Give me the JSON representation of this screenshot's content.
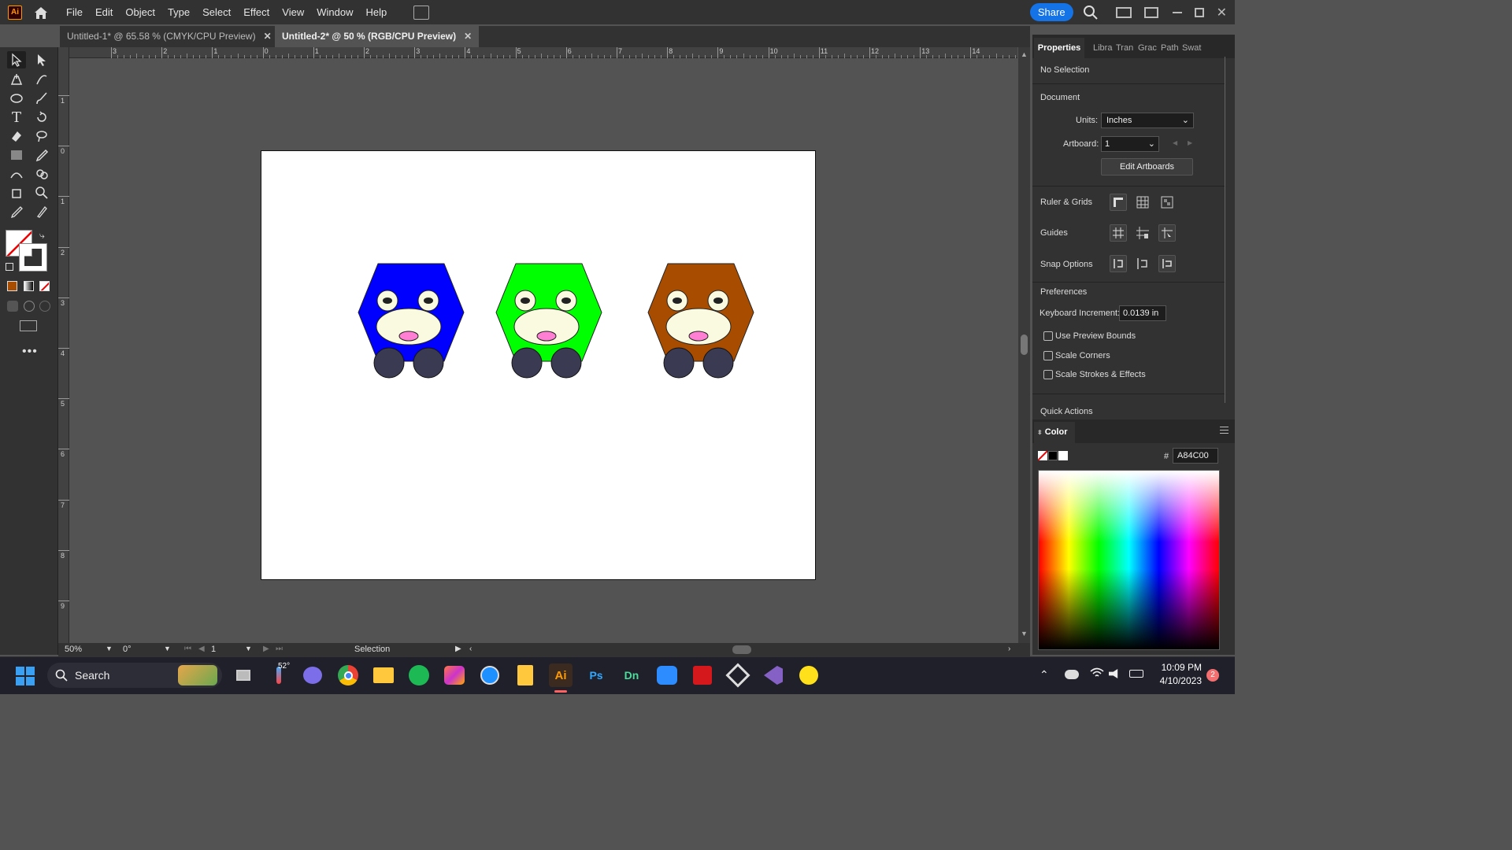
{
  "app": {
    "logo": "Ai"
  },
  "menu": [
    "File",
    "Edit",
    "Object",
    "Type",
    "Select",
    "Effect",
    "View",
    "Window",
    "Help"
  ],
  "titlebar": {
    "share_label": "Share"
  },
  "tabs": [
    {
      "label": "Untitled-1* @ 65.58 % (CMYK/CPU Preview)",
      "close": "✕",
      "active": false
    },
    {
      "label": "Untitled-2* @ 50 % (RGB/CPU Preview)",
      "close": "✕",
      "active": true
    }
  ],
  "ruler_h": [
    "3",
    "2",
    "1",
    "0",
    "1",
    "2",
    "3",
    "4",
    "5",
    "6",
    "7",
    "8",
    "9",
    "10",
    "11",
    "12",
    "13",
    "14"
  ],
  "ruler_v": [
    "1",
    "0",
    "1",
    "2",
    "3",
    "4",
    "5",
    "6",
    "7",
    "8",
    "9"
  ],
  "characters": [
    {
      "name": "blue",
      "body_color": "#0000ff"
    },
    {
      "name": "green",
      "body_color": "#00ff00"
    },
    {
      "name": "brown",
      "body_color": "#a84c00"
    }
  ],
  "character_colors": {
    "belly": "#fafae0",
    "nose": "#ff7fd4",
    "wheel": "#3a3a52",
    "pupil": "#222222"
  },
  "status": {
    "zoom": "50%",
    "rotation": "0°",
    "artboard": "1",
    "tool": "Selection"
  },
  "panel": {
    "tabs": [
      "Properties",
      "Libra",
      "Tran",
      "Grac",
      "Path",
      "Swat"
    ],
    "no_selection": "No Selection",
    "document": "Document",
    "units_label": "Units:",
    "units_value": "Inches",
    "artboard_label": "Artboard:",
    "artboard_value": "1",
    "edit_artboards": "Edit Artboards",
    "ruler_grids": "Ruler & Grids",
    "guides": "Guides",
    "snap_options": "Snap Options",
    "preferences": "Preferences",
    "keyboard_increment_label": "Keyboard Increment:",
    "keyboard_increment_value": "0.0139 in",
    "checkboxes": [
      "Use Preview Bounds",
      "Scale Corners",
      "Scale Strokes & Effects"
    ],
    "quick_actions": "Quick Actions",
    "color_tab": "Color",
    "hex_prefix": "#",
    "hex_value": "A84C00"
  },
  "taskbar": {
    "search": "Search",
    "weather": "52°",
    "time": "10:09 PM",
    "date": "4/10/2023",
    "notifications": "2",
    "apps": [
      "start",
      "search",
      "widgets",
      "task-view",
      "thermo",
      "teams",
      "chrome",
      "explorer",
      "spotify",
      "creative-cloud",
      "safari",
      "files",
      "illustrator",
      "photoshop",
      "dimension",
      "zoom",
      "acrobat",
      "unity",
      "visual-studio",
      "norton"
    ]
  }
}
